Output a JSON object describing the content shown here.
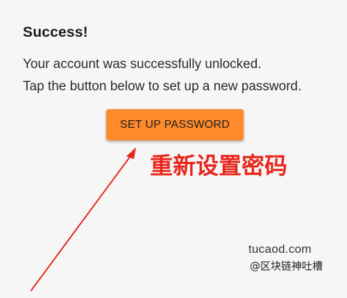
{
  "dialog": {
    "title": "Success!",
    "message_line1": "Your account was successfully unlocked.",
    "message_line2": "Tap the button below to set up a new password.",
    "button_label": "SET UP PASSWORD"
  },
  "annotation": {
    "text": "重新设置密码",
    "color": "#e8261c"
  },
  "watermark": {
    "site": "tucaod.com",
    "handle": "@区块链神吐槽"
  },
  "colors": {
    "background": "#f6f6f7",
    "button": "#ff8a2b"
  }
}
